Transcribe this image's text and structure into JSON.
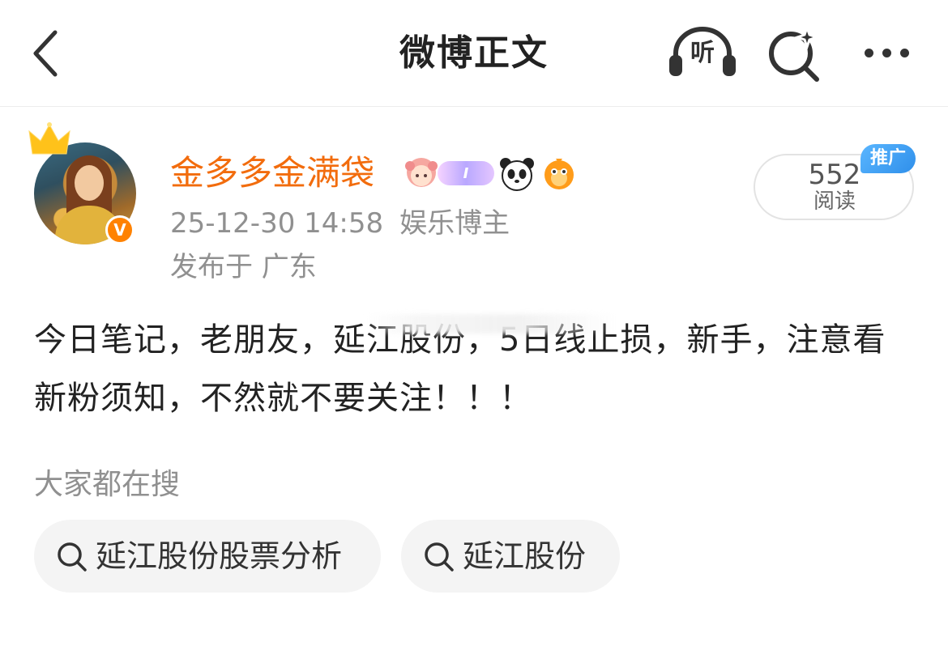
{
  "navbar": {
    "title": "微博正文",
    "back_icon": "chevron-left-icon",
    "listen_label": "听",
    "listen_icon": "headphones-icon",
    "search_icon": "sparkle-search-icon",
    "more_icon": "more-dots-icon"
  },
  "author": {
    "name": "金多多金满袋",
    "verified_badge": "V",
    "verified_color": "#ff8200",
    "name_color": "#f26c0d",
    "badges": [
      "girl-avatar-badge",
      "member-level-badge",
      "panda-badge",
      "fish-badge"
    ],
    "member_badge_text": "I"
  },
  "post": {
    "timestamp": "25-12-30 14:58",
    "author_role": "娱乐博主",
    "location": "发布于 广东",
    "content": "今日笔记，老朋友，延江股份，5日线止损，新手，注意看新粉须知，不然就不要关注！！！"
  },
  "stats": {
    "reads_count": "552",
    "reads_label": "阅读",
    "promo_label": "推广",
    "promo_color": "#2f8fea"
  },
  "related_search": {
    "heading": "大家都在搜",
    "chips": [
      {
        "label": "延江股份股票分析",
        "icon": "search-icon"
      },
      {
        "label": "延江股份",
        "icon": "search-icon"
      }
    ]
  }
}
